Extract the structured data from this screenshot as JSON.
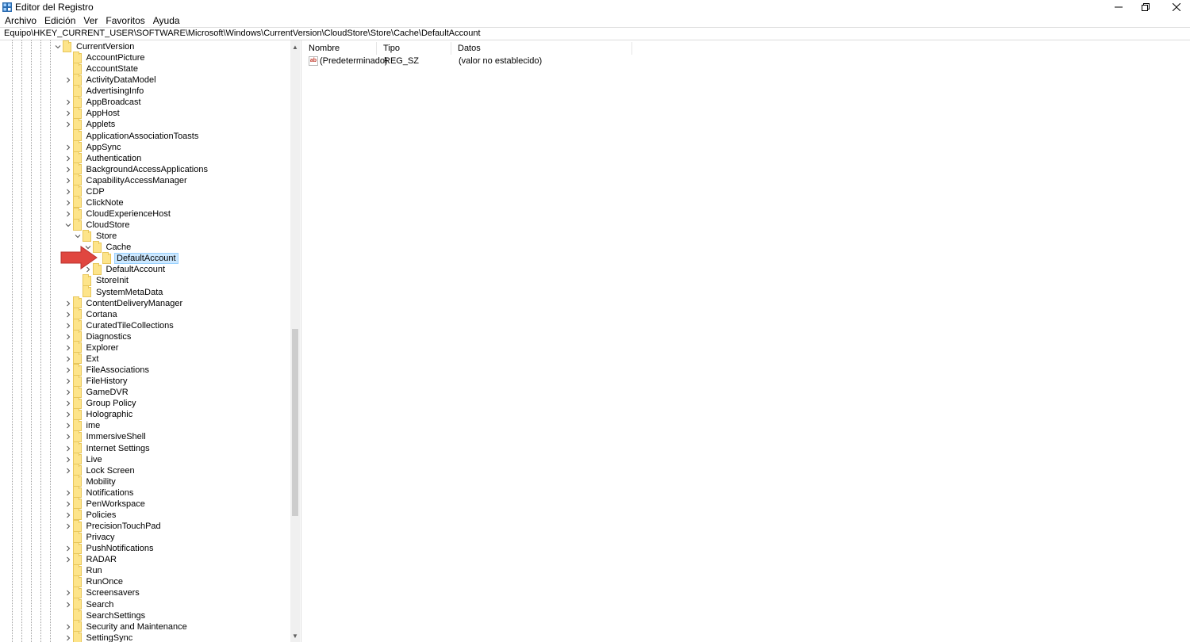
{
  "window": {
    "title": "Editor del Registro"
  },
  "menu": [
    "Archivo",
    "Edición",
    "Ver",
    "Favoritos",
    "Ayuda"
  ],
  "address": "Equipo\\HKEY_CURRENT_USER\\SOFTWARE\\Microsoft\\Windows\\CurrentVersion\\CloudStore\\Store\\Cache\\DefaultAccount",
  "tree": {
    "items": [
      {
        "label": "CurrentVersion",
        "depth": 0,
        "expander": "open"
      },
      {
        "label": "AccountPicture",
        "depth": 1,
        "expander": "none"
      },
      {
        "label": "AccountState",
        "depth": 1,
        "expander": "none"
      },
      {
        "label": "ActivityDataModel",
        "depth": 1,
        "expander": "closed"
      },
      {
        "label": "AdvertisingInfo",
        "depth": 1,
        "expander": "none"
      },
      {
        "label": "AppBroadcast",
        "depth": 1,
        "expander": "closed"
      },
      {
        "label": "AppHost",
        "depth": 1,
        "expander": "closed"
      },
      {
        "label": "Applets",
        "depth": 1,
        "expander": "closed"
      },
      {
        "label": "ApplicationAssociationToasts",
        "depth": 1,
        "expander": "none"
      },
      {
        "label": "AppSync",
        "depth": 1,
        "expander": "closed"
      },
      {
        "label": "Authentication",
        "depth": 1,
        "expander": "closed"
      },
      {
        "label": "BackgroundAccessApplications",
        "depth": 1,
        "expander": "closed"
      },
      {
        "label": "CapabilityAccessManager",
        "depth": 1,
        "expander": "closed"
      },
      {
        "label": "CDP",
        "depth": 1,
        "expander": "closed"
      },
      {
        "label": "ClickNote",
        "depth": 1,
        "expander": "closed"
      },
      {
        "label": "CloudExperienceHost",
        "depth": 1,
        "expander": "closed"
      },
      {
        "label": "CloudStore",
        "depth": 1,
        "expander": "open"
      },
      {
        "label": "Store",
        "depth": 2,
        "expander": "open"
      },
      {
        "label": "Cache",
        "depth": 3,
        "expander": "open"
      },
      {
        "label": "DefaultAccount",
        "depth": 4,
        "expander": "none",
        "selected": true
      },
      {
        "label": "DefaultAccount",
        "depth": 3,
        "expander": "closed"
      },
      {
        "label": "StoreInit",
        "depth": 2,
        "expander": "none"
      },
      {
        "label": "SystemMetaData",
        "depth": 2,
        "expander": "none"
      },
      {
        "label": "ContentDeliveryManager",
        "depth": 1,
        "expander": "closed"
      },
      {
        "label": "Cortana",
        "depth": 1,
        "expander": "closed"
      },
      {
        "label": "CuratedTileCollections",
        "depth": 1,
        "expander": "closed"
      },
      {
        "label": "Diagnostics",
        "depth": 1,
        "expander": "closed"
      },
      {
        "label": "Explorer",
        "depth": 1,
        "expander": "closed"
      },
      {
        "label": "Ext",
        "depth": 1,
        "expander": "closed"
      },
      {
        "label": "FileAssociations",
        "depth": 1,
        "expander": "closed"
      },
      {
        "label": "FileHistory",
        "depth": 1,
        "expander": "closed"
      },
      {
        "label": "GameDVR",
        "depth": 1,
        "expander": "closed"
      },
      {
        "label": "Group Policy",
        "depth": 1,
        "expander": "closed"
      },
      {
        "label": "Holographic",
        "depth": 1,
        "expander": "closed"
      },
      {
        "label": "ime",
        "depth": 1,
        "expander": "closed"
      },
      {
        "label": "ImmersiveShell",
        "depth": 1,
        "expander": "closed"
      },
      {
        "label": "Internet Settings",
        "depth": 1,
        "expander": "closed"
      },
      {
        "label": "Live",
        "depth": 1,
        "expander": "closed"
      },
      {
        "label": "Lock Screen",
        "depth": 1,
        "expander": "closed"
      },
      {
        "label": "Mobility",
        "depth": 1,
        "expander": "none"
      },
      {
        "label": "Notifications",
        "depth": 1,
        "expander": "closed"
      },
      {
        "label": "PenWorkspace",
        "depth": 1,
        "expander": "closed"
      },
      {
        "label": "Policies",
        "depth": 1,
        "expander": "closed"
      },
      {
        "label": "PrecisionTouchPad",
        "depth": 1,
        "expander": "closed"
      },
      {
        "label": "Privacy",
        "depth": 1,
        "expander": "none"
      },
      {
        "label": "PushNotifications",
        "depth": 1,
        "expander": "closed"
      },
      {
        "label": "RADAR",
        "depth": 1,
        "expander": "closed"
      },
      {
        "label": "Run",
        "depth": 1,
        "expander": "none"
      },
      {
        "label": "RunOnce",
        "depth": 1,
        "expander": "none"
      },
      {
        "label": "Screensavers",
        "depth": 1,
        "expander": "closed"
      },
      {
        "label": "Search",
        "depth": 1,
        "expander": "closed"
      },
      {
        "label": "SearchSettings",
        "depth": 1,
        "expander": "none"
      },
      {
        "label": "Security and Maintenance",
        "depth": 1,
        "expander": "closed"
      },
      {
        "label": "SettingSync",
        "depth": 1,
        "expander": "closed"
      }
    ]
  },
  "values": {
    "columns": [
      "Nombre",
      "Tipo",
      "Datos"
    ],
    "rows": [
      {
        "icon": "string-value-icon",
        "name": "(Predeterminado)",
        "type": "REG_SZ",
        "data": "(valor no establecido)"
      }
    ]
  },
  "annotation": {
    "icon": "red-arrow-icon",
    "color": "#e0463f"
  }
}
